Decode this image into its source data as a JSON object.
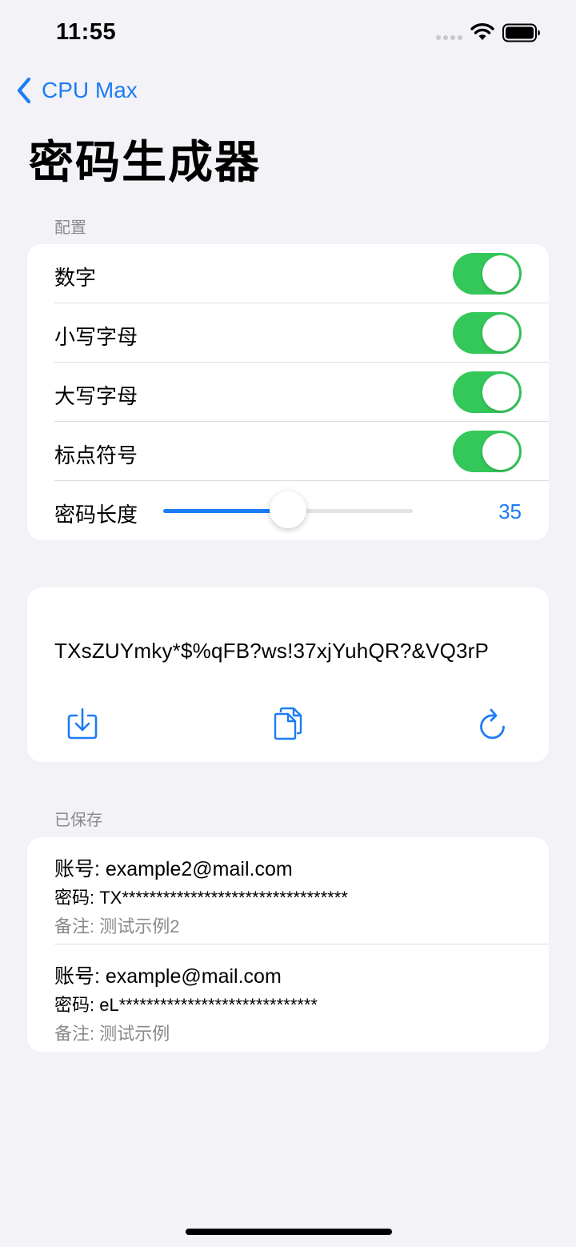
{
  "status_bar": {
    "time": "11:55"
  },
  "nav": {
    "back_label": "CPU Max",
    "title": "密码生成器"
  },
  "config": {
    "header": "配置",
    "toggles": [
      {
        "label": "数字",
        "on": true
      },
      {
        "label": "小写字母",
        "on": true
      },
      {
        "label": "大写字母",
        "on": true
      },
      {
        "label": "标点符号",
        "on": true
      }
    ],
    "length_label": "密码长度",
    "length_value": "35",
    "slider_fraction": 0.5
  },
  "generated": {
    "password": "TXsZUYmky*$%qFB?ws!37xjYuhQR?&VQ3rP",
    "icons": [
      "save-icon",
      "copy-icon",
      "refresh-icon"
    ]
  },
  "saved": {
    "header": "已保存",
    "items": [
      {
        "account": "账号: example2@mail.com",
        "password": "密码: TX*********************************",
        "note": "备注: 测试示例2"
      },
      {
        "account": "账号: example@mail.com",
        "password": "密码: eL*****************************",
        "note": "备注: 测试示例"
      }
    ]
  },
  "colors": {
    "accent": "#1c7cf5",
    "toggle_on": "#34c759",
    "background": "#f2f2f7"
  }
}
